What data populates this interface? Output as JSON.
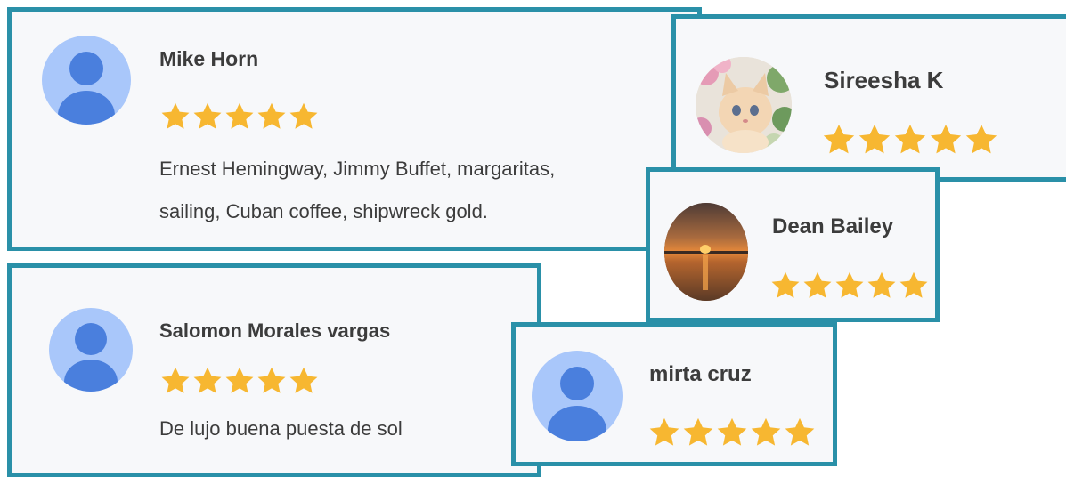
{
  "colors": {
    "card_border": "#2a90a8",
    "card_background": "#f7f8fa",
    "star": "#f7b731",
    "avatar_light": "#a9c7fa",
    "avatar_dark": "#4a7fdd",
    "text": "#3c3c3c"
  },
  "reviews": [
    {
      "name": "Mike Horn",
      "rating": 5,
      "avatar": "default-person-icon",
      "text_lines": [
        "Ernest Hemingway, Jimmy Buffet, margaritas,",
        "sailing, Cuban coffee, shipwreck gold."
      ]
    },
    {
      "name": "Salomon Morales vargas",
      "rating": 5,
      "avatar": "default-person-icon",
      "text_lines": [
        "De lujo buena puesta de sol"
      ]
    },
    {
      "name": "Sireesha K",
      "rating": 5,
      "avatar": "kitten-photo"
    },
    {
      "name": "Dean Bailey",
      "rating": 5,
      "avatar": "sunset-photo"
    },
    {
      "name": "mirta cruz",
      "rating": 5,
      "avatar": "default-person-icon"
    }
  ]
}
